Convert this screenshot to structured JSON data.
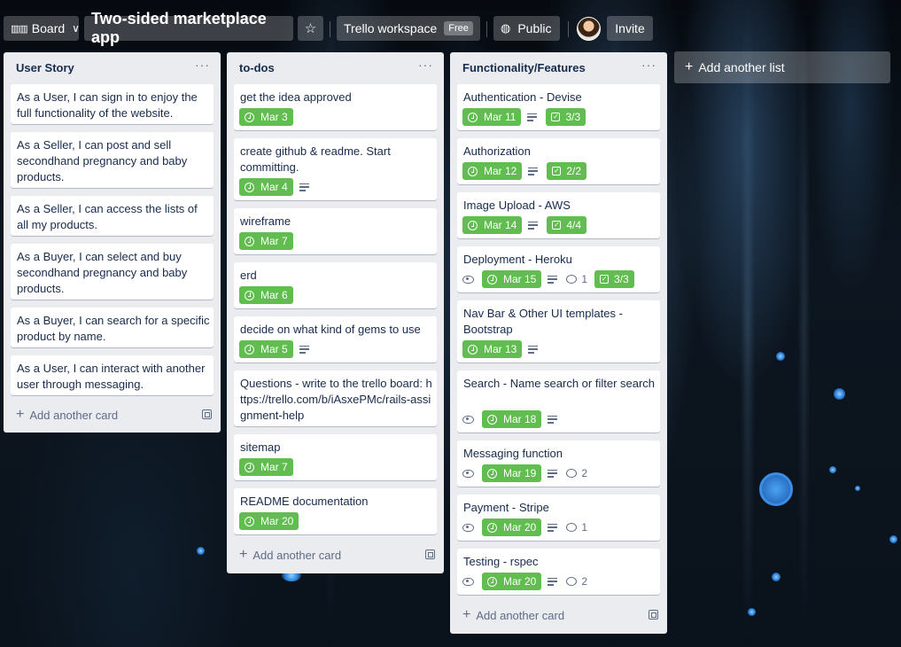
{
  "header": {
    "board_label": "Board",
    "board_title": "Two-sided marketplace app",
    "workspace_label": "Trello workspace",
    "workspace_badge": "Free",
    "visibility_label": "Public",
    "invite_label": "Invite"
  },
  "lists": [
    {
      "title": "User Story",
      "add_card_label": "Add another card",
      "cards": [
        {
          "text": "As a User, I can sign in to enjoy the full functionality of the website."
        },
        {
          "text": "As a Seller, I can post and sell secondhand pregnancy and baby products."
        },
        {
          "text": "As a Seller, I can access the lists of all my products."
        },
        {
          "text": "As a Buyer, I can select and buy secondhand pregnancy and baby products."
        },
        {
          "text": "As a Buyer, I can search for a specific product by name."
        },
        {
          "text": "As a User, I can interact with another user through messaging."
        }
      ]
    },
    {
      "title": "to-dos",
      "add_card_label": "Add another card",
      "cards": [
        {
          "text": "get the idea approved",
          "due": "Mar 3"
        },
        {
          "text": "create github & readme. Start committing.",
          "due": "Mar 4",
          "description": true
        },
        {
          "text": "wireframe",
          "due": "Mar 7"
        },
        {
          "text": "erd",
          "due": "Mar 6"
        },
        {
          "text": "decide on what kind of gems to use",
          "due": "Mar 5",
          "description": true
        },
        {
          "text": "Questions - write to the trello board: https://trello.com/b/iAsxePMc/rails-assignment-help"
        },
        {
          "text": "sitemap",
          "due": "Mar 7"
        },
        {
          "text": "README documentation",
          "due": "Mar 20"
        }
      ]
    },
    {
      "title": "Functionality/Features",
      "add_card_label": "Add another card",
      "cards": [
        {
          "text": "Authentication - Devise",
          "due": "Mar 11",
          "description": true,
          "checklist": "3/3"
        },
        {
          "text": "Authorization",
          "due": "Mar 12",
          "description": true,
          "checklist": "2/2"
        },
        {
          "text": "Image Upload - AWS",
          "due": "Mar 14",
          "description": true,
          "checklist": "4/4"
        },
        {
          "text": "Deployment - Heroku",
          "watching": true,
          "due": "Mar 15",
          "description": true,
          "comments": "1",
          "checklist": "3/3"
        },
        {
          "text": "Nav Bar & Other UI templates - Bootstrap",
          "due": "Mar 13",
          "description": true
        },
        {
          "text": "Search - Name search or filter search",
          "watching": true,
          "due": "Mar 18",
          "description": true
        },
        {
          "text": "Messaging function",
          "watching": true,
          "due": "Mar 19",
          "description": true,
          "comments": "2"
        },
        {
          "text": "Payment - Stripe",
          "watching": true,
          "due": "Mar 20",
          "description": true,
          "comments": "1"
        },
        {
          "text": "Testing - rspec",
          "watching": true,
          "due": "Mar 20",
          "description": true,
          "comments": "2"
        }
      ]
    }
  ],
  "add_list_label": "Add another list",
  "colors": {
    "due_complete": "#61bd4f",
    "list_bg": "#ebecf0",
    "text": "#172b4d",
    "muted": "#5e6c84"
  }
}
